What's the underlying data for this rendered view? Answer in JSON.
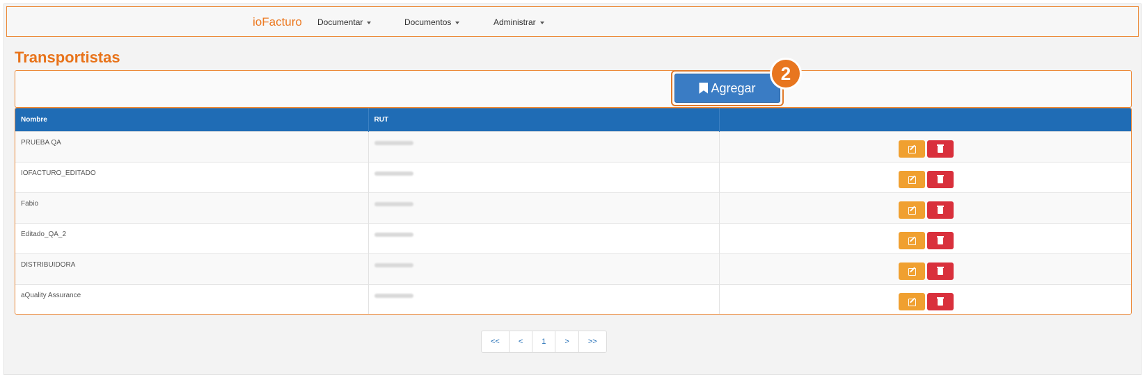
{
  "navbar": {
    "brand": "ioFacturo",
    "menus": [
      {
        "label": "Documentar"
      },
      {
        "label": "Documentos"
      },
      {
        "label": "Administrar"
      }
    ]
  },
  "page_title": "Transportistas",
  "toolbar": {
    "add_label": "Agregar",
    "step_badge": "2"
  },
  "table": {
    "columns": [
      "Nombre",
      "RUT",
      ""
    ],
    "rows": [
      {
        "nombre": "PRUEBA QA"
      },
      {
        "nombre": "IOFACTURO_EDITADO"
      },
      {
        "nombre": "Fabio"
      },
      {
        "nombre": "Editado_QA_2"
      },
      {
        "nombre": "DISTRIBUIDORA"
      },
      {
        "nombre": "aQuality Assurance"
      }
    ]
  },
  "pagination": {
    "first": "<<",
    "prev": "<",
    "current": "1",
    "next": ">",
    "last": ">>"
  },
  "colors": {
    "accent": "#e8731a",
    "header_blue": "#1f6cb5",
    "edit": "#f0a030",
    "delete": "#d9303c"
  }
}
